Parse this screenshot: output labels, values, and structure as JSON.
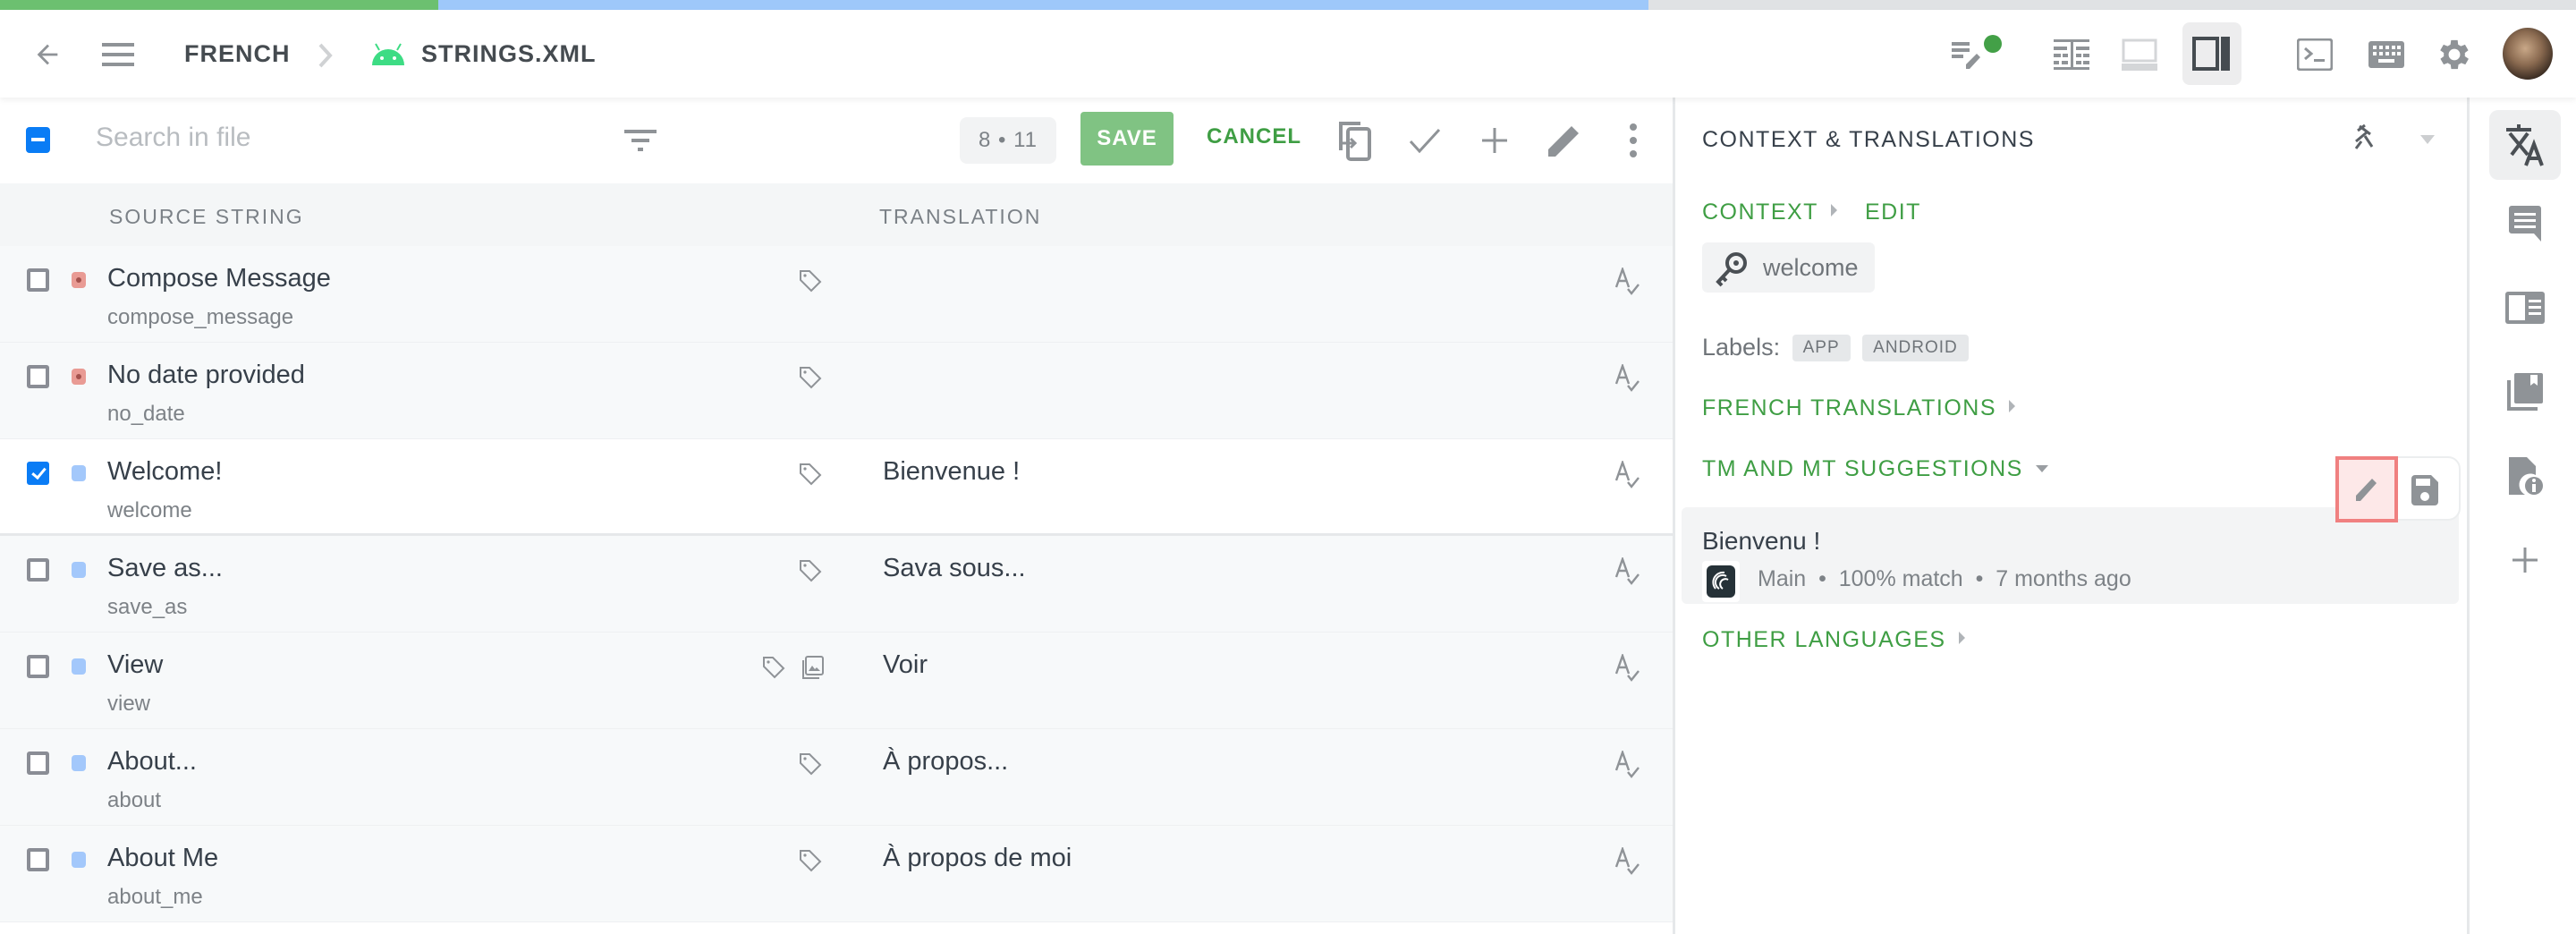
{
  "progress": {
    "approved_fraction": 0.17,
    "translated_fraction": 0.47
  },
  "header": {
    "breadcrumb": [
      {
        "label": "FRENCH"
      },
      {
        "label": "STRINGS.XML",
        "icon": "android-icon"
      }
    ],
    "right_icons": [
      "edit-notes-icon",
      "side-by-side-icon",
      "horizontal-split-icon",
      "vertical-split-icon",
      "terminal-icon",
      "keyboard-icon",
      "settings-icon",
      "avatar"
    ],
    "notification_dot_color": "#4caf50"
  },
  "toolbar": {
    "search_placeholder": "Search in file",
    "counter": "8 • 11",
    "save_label": "SAVE",
    "cancel_label": "CANCEL"
  },
  "table": {
    "columns": {
      "source": "SOURCE STRING",
      "translation": "TRANSLATION"
    },
    "rows": [
      {
        "source": "Compose Message",
        "key": "compose_message",
        "translation": "",
        "status": "untranslated",
        "checked": false,
        "has_image": false
      },
      {
        "source": "No date provided",
        "key": "no_date",
        "translation": "",
        "status": "untranslated",
        "checked": false,
        "has_image": false
      },
      {
        "source": "Welcome!",
        "key": "welcome",
        "translation": "Bienvenue !",
        "status": "translated",
        "checked": true,
        "has_image": false
      },
      {
        "source": "Save as...",
        "key": "save_as",
        "translation": "Sava sous...",
        "status": "translated",
        "checked": false,
        "has_image": false
      },
      {
        "source": "View",
        "key": "view",
        "translation": "Voir",
        "status": "translated",
        "checked": false,
        "has_image": true
      },
      {
        "source": "About...",
        "key": "about",
        "translation": "À propos...",
        "status": "translated",
        "checked": false,
        "has_image": false
      },
      {
        "source": "About Me",
        "key": "about_me",
        "translation": "À propos de moi",
        "status": "translated",
        "checked": false,
        "has_image": false
      }
    ]
  },
  "panel": {
    "title": "CONTEXT & TRANSLATIONS",
    "context_label": "CONTEXT",
    "edit_label": "EDIT",
    "key_value": "welcome",
    "labels_prefix": "Labels:",
    "labels": [
      "APP",
      "ANDROID"
    ],
    "french_translations_label": "FRENCH TRANSLATIONS",
    "suggestions_label": "TM AND MT SUGGESTIONS",
    "suggestion": {
      "text": "Bienvenu !",
      "source": "Main",
      "match": "100% match",
      "age": "7 months ago"
    },
    "other_languages_label": "OTHER LANGUAGES"
  },
  "rail": [
    "translate-icon",
    "comments-icon",
    "glossary-icon",
    "translation-memory-icon",
    "file-info-icon",
    "add-icon"
  ]
}
